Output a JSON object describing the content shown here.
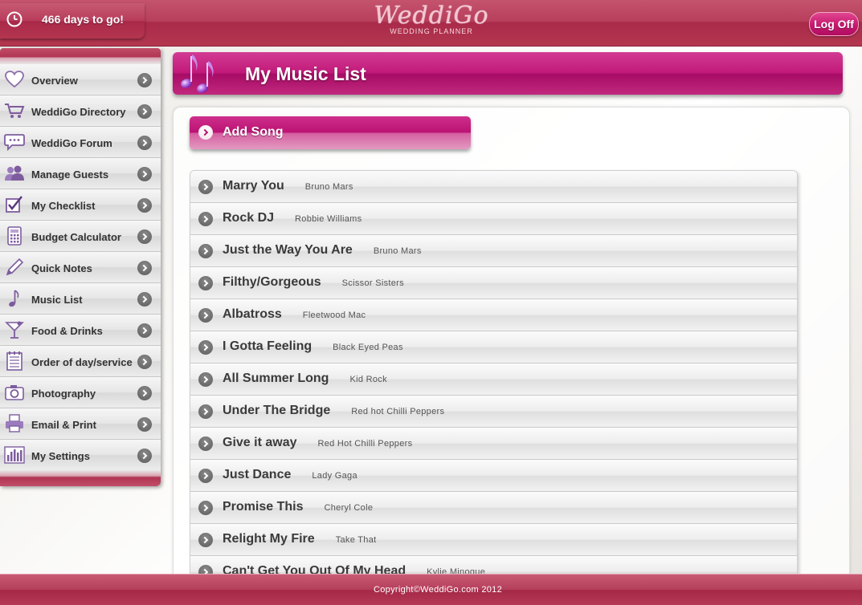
{
  "header": {
    "countdown": "466 days to go!",
    "logo_main": "WeddiGo",
    "logo_sub": "WEDDING PLANNER",
    "logoff_label": "Log Off"
  },
  "sidebar": {
    "items": [
      {
        "label": "Overview",
        "icon": "heart-icon"
      },
      {
        "label": "WeddiGo Directory",
        "icon": "cart-icon"
      },
      {
        "label": "WeddiGo Forum",
        "icon": "speech-bubble-icon"
      },
      {
        "label": "Manage Guests",
        "icon": "people-icon"
      },
      {
        "label": "My Checklist",
        "icon": "checkbox-icon"
      },
      {
        "label": "Budget Calculator",
        "icon": "calculator-icon"
      },
      {
        "label": "Quick Notes",
        "icon": "pencil-icon"
      },
      {
        "label": "Music List",
        "icon": "music-note-icon"
      },
      {
        "label": "Food & Drinks",
        "icon": "cocktail-icon"
      },
      {
        "label": "Order of day/service",
        "icon": "notepad-icon"
      },
      {
        "label": "Photography",
        "icon": "camera-icon"
      },
      {
        "label": "Email & Print",
        "icon": "printer-icon"
      },
      {
        "label": "My Settings",
        "icon": "bar-chart-icon"
      }
    ]
  },
  "main": {
    "title": "My Music List",
    "add_song_label": "Add Song",
    "songs": [
      {
        "title": "Marry You",
        "artist": "Bruno Mars"
      },
      {
        "title": "Rock DJ",
        "artist": "Robbie Williams"
      },
      {
        "title": "Just the Way You Are",
        "artist": "Bruno Mars"
      },
      {
        "title": "Filthy/Gorgeous",
        "artist": "Scissor Sisters"
      },
      {
        "title": "Albatross",
        "artist": "Fleetwood Mac"
      },
      {
        "title": "I Gotta Feeling",
        "artist": "Black Eyed Peas"
      },
      {
        "title": "All Summer Long",
        "artist": "Kid Rock"
      },
      {
        "title": "Under The Bridge",
        "artist": "Red hot Chilli Peppers"
      },
      {
        "title": "Give it away",
        "artist": "Red Hot Chilli Peppers"
      },
      {
        "title": "Just Dance",
        "artist": "Lady Gaga"
      },
      {
        "title": "Promise This",
        "artist": "Cheryl Cole"
      },
      {
        "title": "Relight My Fire",
        "artist": "Take That"
      },
      {
        "title": "Can't Get You Out Of My Head",
        "artist": "Kylie Minogue"
      }
    ]
  },
  "footer": {
    "copyright": "Copyright©WeddiGo.com 2012"
  },
  "colors": {
    "brand_pink": "#c21a7b",
    "header_red": "#b03654",
    "text_dark": "#333333"
  }
}
